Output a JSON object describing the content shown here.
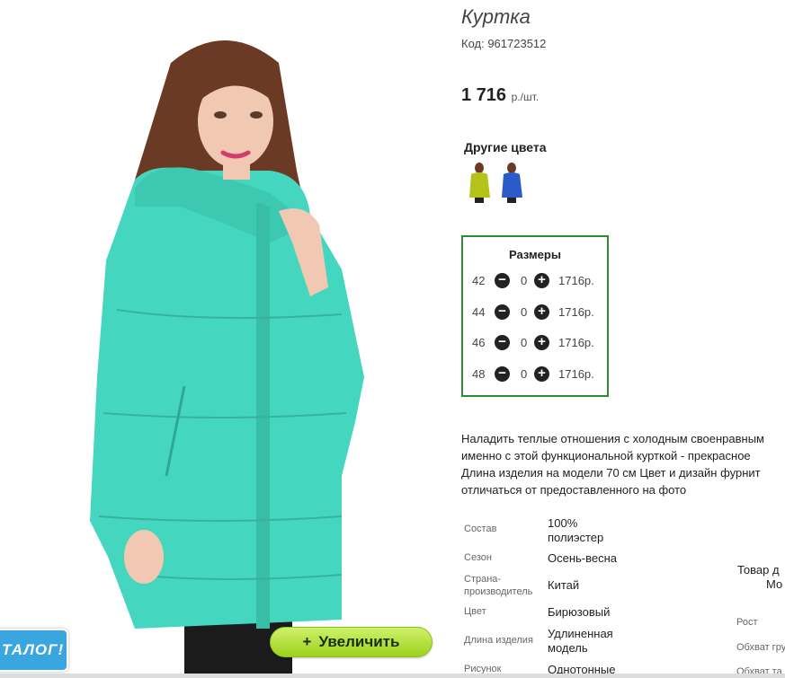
{
  "product": {
    "title": "Куртка",
    "code_label": "Код: 961723512",
    "price": "1 716",
    "price_unit": "р./шт."
  },
  "other_colors": {
    "title": "Другие цвета",
    "swatches": [
      {
        "name": "yellow-green",
        "color": "#b4c21a"
      },
      {
        "name": "blue",
        "color": "#2a5bc7"
      }
    ]
  },
  "sizes": {
    "title": "Размеры",
    "rows": [
      {
        "size": "42",
        "qty": "0",
        "price": "1716р."
      },
      {
        "size": "44",
        "qty": "0",
        "price": "1716р."
      },
      {
        "size": "46",
        "qty": "0",
        "price": "1716р."
      },
      {
        "size": "48",
        "qty": "0",
        "price": "1716р."
      }
    ]
  },
  "description": {
    "lines": [
      "Наладить теплые отношения с холодным своенравным",
      "именно с этой функциональной курткой - прекрасное",
      "Длина изделия на модели 70 см Цвет и дизайн фурнит",
      "отличаться от предоставленного на фото"
    ]
  },
  "properties": [
    {
      "label": "Состав",
      "value": "100%\nполиэстер"
    },
    {
      "label": "Сезон",
      "value": "Осень-весна"
    },
    {
      "label": "Страна-\nпроизводитель",
      "value": "Китай"
    },
    {
      "label": "Цвет",
      "value": "Бирюзовый"
    },
    {
      "label": "Длина изделия",
      "value": "Удлиненная\nмодель"
    },
    {
      "label": "Рисунок",
      "value": "Однотонные"
    }
  ],
  "side": {
    "tovar_label": "Товар д",
    "tovar_sub": "Мо",
    "rost": "Рост",
    "obhvat": "Обхват гру",
    "obhvat2": "Обхват та"
  },
  "buttons": {
    "zoom": "Увеличить",
    "catalog": "ТАЛОГ!"
  },
  "colors": {
    "jacket": "#45d6bf",
    "sizes_border": "#2d8a2d",
    "zoom_button": "#b5e23a",
    "catalog_tab": "#3aa6e0"
  }
}
